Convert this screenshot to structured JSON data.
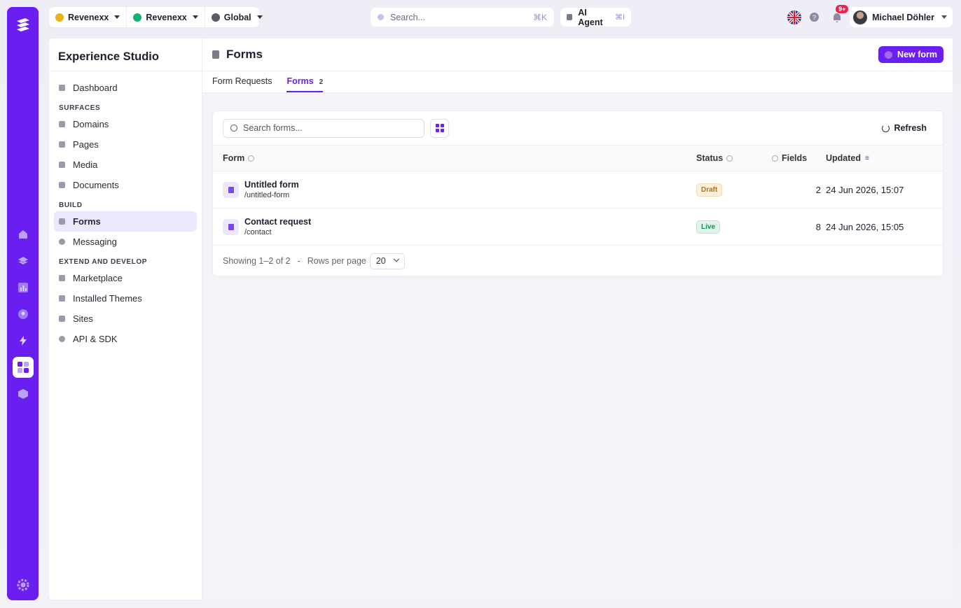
{
  "topbar": {
    "contexts": [
      {
        "label": "Revenexx",
        "color": "#e8b21a"
      },
      {
        "label": "Revenexx",
        "color": "#13b36f"
      },
      {
        "label": "Global",
        "color": "#5a5a6a"
      }
    ],
    "search": {
      "placeholder": "Search...",
      "shortcut": "⌘K"
    },
    "ai_agent": {
      "label": "AI Agent",
      "shortcut": "⌘I"
    },
    "notifications_badge": "9+",
    "help_label": "?",
    "user_name": "Michael Döhler"
  },
  "sidebar": {
    "title": "Experience Studio",
    "top_items": [
      {
        "label": "Dashboard"
      }
    ],
    "sections": [
      {
        "title": "Surfaces",
        "items": [
          {
            "label": "Domains"
          },
          {
            "label": "Pages"
          },
          {
            "label": "Media"
          },
          {
            "label": "Documents"
          }
        ]
      },
      {
        "title": "Build",
        "items": [
          {
            "label": "Forms",
            "active": true
          },
          {
            "label": "Messaging"
          }
        ]
      },
      {
        "title": "Extend and develop",
        "items": [
          {
            "label": "Marketplace"
          },
          {
            "label": "Installed Themes"
          },
          {
            "label": "Sites"
          },
          {
            "label": "API & SDK"
          }
        ]
      }
    ]
  },
  "main": {
    "title": "Forms",
    "new_button": "New form",
    "tabs": [
      {
        "label": "Form Requests",
        "active": false,
        "count": ""
      },
      {
        "label": "Forms",
        "active": true,
        "count": "2"
      }
    ],
    "search_placeholder": "Search forms...",
    "refresh_label": "Refresh",
    "columns": {
      "form": "Form",
      "status": "Status",
      "fields": "Fields",
      "updated": "Updated"
    },
    "rows": [
      {
        "name": "Untitled form",
        "slug": "/untitled-form",
        "status": "Draft",
        "fields": "2",
        "updated": "24 Jun 2026, 15:07"
      },
      {
        "name": "Contact request",
        "slug": "/contact",
        "status": "Live",
        "fields": "8",
        "updated": "24 Jun 2026, 15:05"
      }
    ],
    "footer": {
      "showing": "Showing 1–2 of 2",
      "separator": "-",
      "rows_per_page_label": "Rows per page",
      "rows_per_page": "20"
    }
  },
  "colors": {
    "accent": "#6a1ff0",
    "draft": "#b86e11",
    "live": "#1f8a53"
  }
}
